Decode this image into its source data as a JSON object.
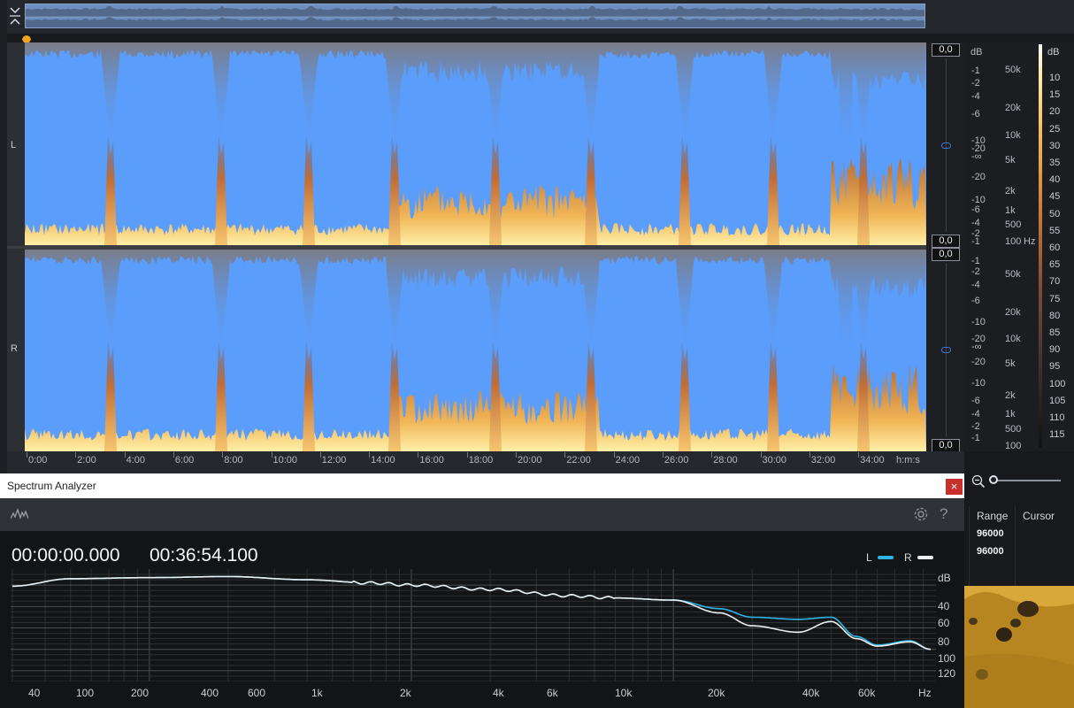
{
  "overview": {
    "collapse_icon": "collapse-chevrons-icon"
  },
  "channels": {
    "left_label": "L",
    "right_label": "R"
  },
  "amplitude": {
    "top_left_value": "0,0",
    "bottom_left_value": "0,0",
    "top_right_value": "0,0",
    "bottom_right_value": "0,0"
  },
  "scale": {
    "db_unit": "dB",
    "db_left_channel": [
      "-1",
      "-2",
      "-4",
      "-6",
      "-10",
      "-20",
      "-∞",
      "-20",
      "-10",
      "-6",
      "-4",
      "-2",
      "-1"
    ],
    "db_right_channel": [
      "-1",
      "-2",
      "-4",
      "-6",
      "-10",
      "-20",
      "-∞",
      "-20",
      "-10",
      "-6",
      "-4",
      "-2",
      "-1"
    ],
    "hz_left_channel": [
      "50k",
      "20k",
      "10k",
      "5k",
      "2k",
      "1k",
      "500",
      "100"
    ],
    "hz_right_channel": [
      "50k",
      "20k",
      "10k",
      "5k",
      "2k",
      "1k",
      "500",
      "100"
    ],
    "hz_unit": "Hz",
    "colorbar_unit": "dB",
    "colorbar_values": [
      "10",
      "15",
      "20",
      "25",
      "30",
      "35",
      "40",
      "45",
      "50",
      "55",
      "60",
      "65",
      "70",
      "75",
      "80",
      "85",
      "90",
      "95",
      "100",
      "105",
      "110",
      "115"
    ]
  },
  "ruler": {
    "labels": [
      "0:00",
      "2:00",
      "4:00",
      "6:00",
      "8:00",
      "10:00",
      "12:00",
      "14:00",
      "16:00",
      "18:00",
      "20:00",
      "22:00",
      "24:00",
      "26:00",
      "28:00",
      "30:00",
      "32:00",
      "34:00"
    ],
    "unit": "h:m:s"
  },
  "right_panel": {
    "range_header": "Range",
    "cursor_header": "Cursor",
    "range_values": [
      "96000",
      "96000"
    ]
  },
  "spectrum_analyzer": {
    "window_title": "Spectrum Analyzer",
    "close_label": "×",
    "help_label": "?",
    "start_time": "00:00:00.000",
    "end_time": "00:36:54.100",
    "legend": [
      {
        "label": "L",
        "color": "#2cb6e5"
      },
      {
        "label": "R",
        "color": "#eeeeee"
      }
    ],
    "db_unit": "dB",
    "db_labels": [
      "40",
      "60",
      "80",
      "100",
      "120"
    ],
    "hz_labels": [
      "40",
      "100",
      "200",
      "400",
      "600",
      "1k",
      "2k",
      "4k",
      "6k",
      "10k",
      "20k",
      "40k",
      "60k",
      "Hz"
    ]
  },
  "chart_data": {
    "type": "line",
    "xlabel": "Hz",
    "ylabel": "dB",
    "x_scale": "log",
    "xlim": [
      30,
      96000
    ],
    "ylim": [
      130,
      25
    ],
    "grid": true,
    "legend_position": "top-right",
    "x": [
      30,
      50,
      100,
      200,
      400,
      700,
      1000,
      2000,
      4000,
      6000,
      10000,
      15000,
      20000,
      30000,
      40000,
      50000,
      60000,
      80000,
      96000
    ],
    "series": [
      {
        "name": "L",
        "color": "#2cb6e5",
        "values": [
          41,
          34,
          33,
          32,
          35,
          38,
          40,
          44,
          50,
          52,
          54,
          62,
          70,
          72,
          70,
          88,
          96,
          92,
          100
        ]
      },
      {
        "name": "R",
        "color": "#eeeeee",
        "values": [
          41,
          34,
          33,
          32,
          35,
          38,
          40,
          44,
          50,
          52,
          54,
          66,
          78,
          84,
          74,
          90,
          97,
          93,
          100
        ]
      }
    ]
  }
}
